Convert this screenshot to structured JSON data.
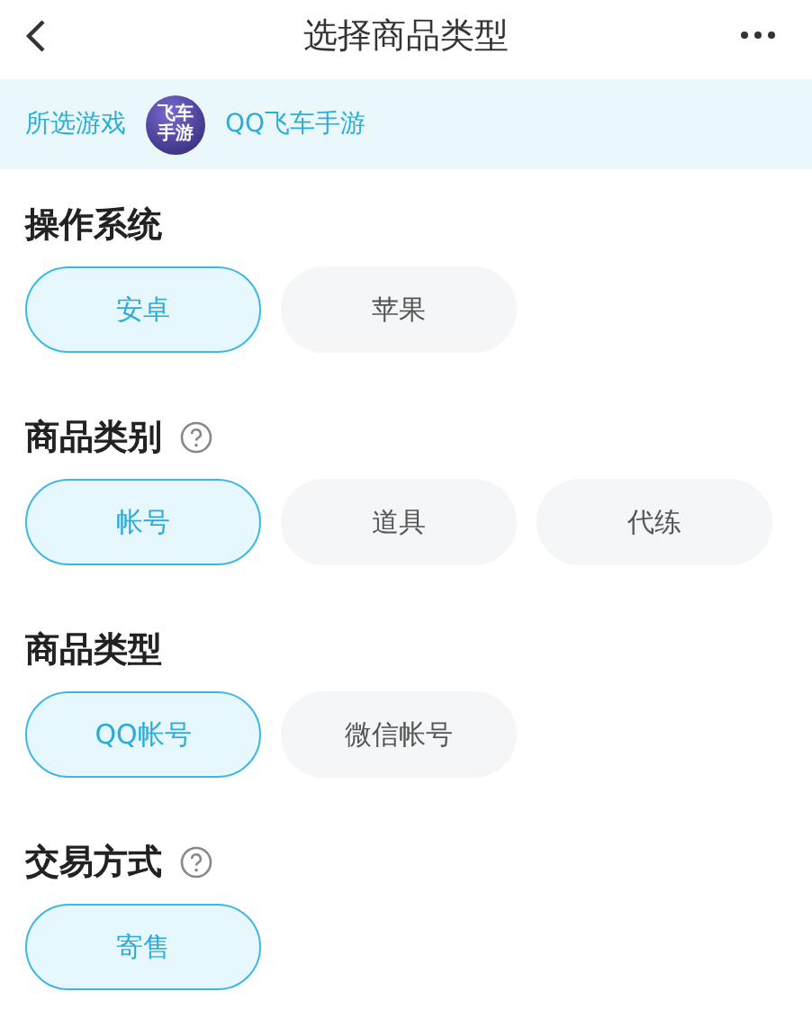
{
  "header": {
    "title": "选择商品类型"
  },
  "selected_game": {
    "label": "所选游戏",
    "logo_text": [
      "飞车",
      "手游"
    ],
    "name": "QQ飞车手游"
  },
  "sections": [
    {
      "title": "操作系统",
      "help": false,
      "options": [
        {
          "label": "安卓",
          "selected": true
        },
        {
          "label": "苹果",
          "selected": false
        }
      ]
    },
    {
      "title": "商品类别",
      "help": true,
      "options": [
        {
          "label": "帐号",
          "selected": true
        },
        {
          "label": "道具",
          "selected": false
        },
        {
          "label": "代练",
          "selected": false
        }
      ]
    },
    {
      "title": "商品类型",
      "help": false,
      "options": [
        {
          "label": "QQ帐号",
          "selected": true
        },
        {
          "label": "微信帐号",
          "selected": false
        }
      ]
    },
    {
      "title": "交易方式",
      "help": true,
      "options": [
        {
          "label": "寄售",
          "selected": true
        }
      ]
    }
  ]
}
